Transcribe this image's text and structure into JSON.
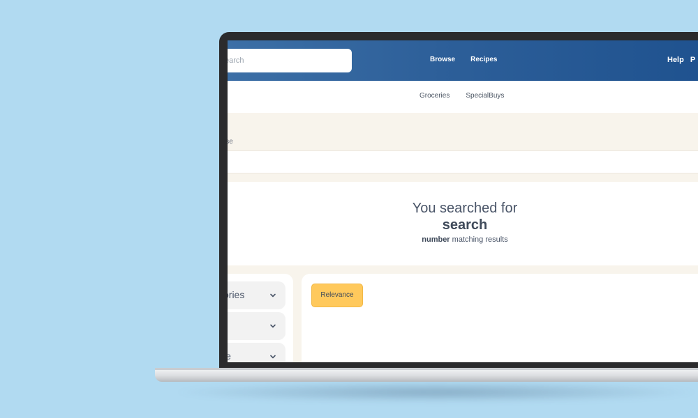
{
  "header": {
    "search_placeholder": "earch",
    "nav": [
      "Browse",
      "Recipes"
    ],
    "right_links": [
      "Help",
      "P"
    ]
  },
  "subnav": {
    "links": [
      "Groceries",
      "SpecialBuys"
    ]
  },
  "breadcrumb": {
    "text": "wse"
  },
  "results": {
    "heading": "You searched for",
    "query": "search",
    "count_label": "number",
    "count_suffix": " matching results"
  },
  "filters": {
    "items": [
      {
        "label": "ories",
        "icon": "chevron-down-icon"
      },
      {
        "label": "",
        "icon": "chevron-down-icon"
      },
      {
        "label": "le",
        "icon": "chevron-down-icon"
      }
    ]
  },
  "sort": {
    "label": "Relevance"
  },
  "colors": {
    "background": "#b1daf1",
    "header_start": "#3c6fa6",
    "header_end": "#1f528f",
    "accent_button": "#ffc95c",
    "cream": "#f8f4ec"
  }
}
